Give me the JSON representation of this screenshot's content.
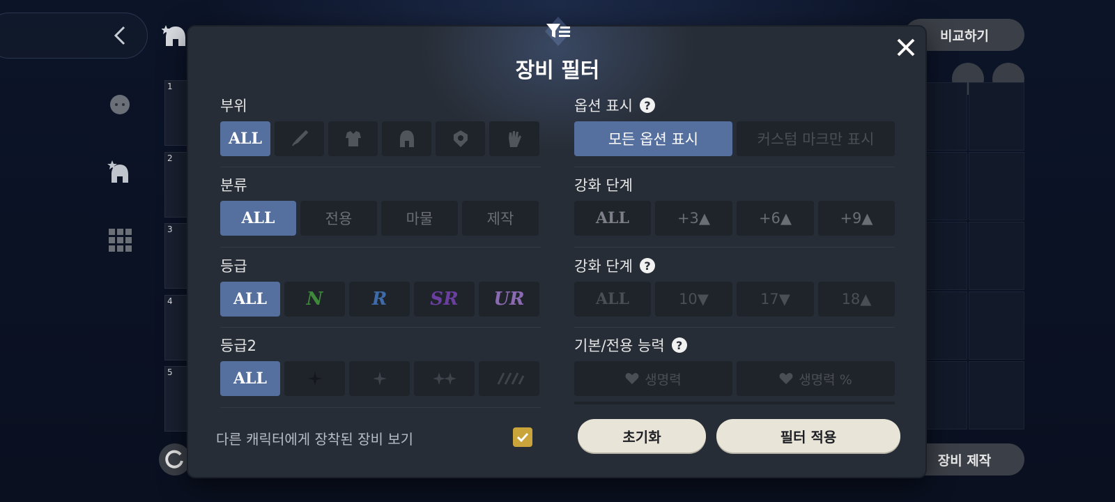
{
  "background": {
    "list_numbers": [
      "1",
      "2",
      "3",
      "4",
      "5"
    ],
    "compare_label": "비교하기",
    "craft_label": "장비 제작"
  },
  "modal": {
    "title": "장비 필터",
    "left": {
      "part": {
        "label": "부위",
        "options": [
          "ALL",
          "sword-icon",
          "armor-icon",
          "helmet-icon",
          "accessory-icon",
          "glove-icon"
        ],
        "selected": "ALL"
      },
      "category": {
        "label": "분류",
        "options": [
          "ALL",
          "전용",
          "마물",
          "제작"
        ],
        "selected": "ALL"
      },
      "grade": {
        "label": "등급",
        "options": [
          "ALL",
          "N",
          "R",
          "SR",
          "UR"
        ],
        "selected": "ALL",
        "colors": {
          "N": "#3f8a3a",
          "R": "#3e6aa8",
          "SR": "#6b3fa0",
          "UR": "#8a6ab0"
        }
      },
      "grade2": {
        "label": "등급2",
        "options": [
          "ALL",
          "star-1-icon",
          "star-2-icon",
          "star-3-icon",
          "star-4-icon"
        ],
        "selected": "ALL"
      },
      "equipped_text": "다른 캐릭터에게 장착된 장비 보기",
      "equipped_checked": true
    },
    "right": {
      "option_display": {
        "label": "옵션 표시",
        "options": [
          "모든 옵션 표시",
          "커스텀 마크만 표시"
        ],
        "selected": "모든 옵션 표시"
      },
      "enhance": {
        "label": "강화 단계",
        "options": [
          "ALL",
          "+3▲",
          "+6▲",
          "+9▲"
        ],
        "selected": "none"
      },
      "enhance2": {
        "label": "강화 단계",
        "options": [
          "ALL",
          "10▼",
          "17▼",
          "18▲"
        ],
        "selected": "none"
      },
      "ability": {
        "label": "기본/전용 능력",
        "options": [
          "생명력",
          "생명력 %"
        ]
      }
    },
    "reset_label": "초기화",
    "apply_label": "필터 적용"
  },
  "colors": {
    "accent": "#55709e",
    "checkbox": "#c9a43a",
    "button_bg": "#1f232a",
    "modal_bg": "#272d36"
  }
}
